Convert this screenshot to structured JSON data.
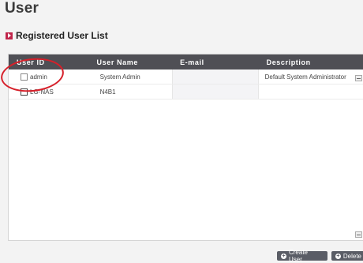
{
  "page": {
    "title": "User"
  },
  "section": {
    "title": "Registered User List"
  },
  "table": {
    "columns": [
      "User ID",
      "User Name",
      "E-mail",
      "Description"
    ],
    "rows": [
      {
        "user_id": "admin",
        "user_name": "System Admin",
        "email": "",
        "description": "Default System Administrator"
      },
      {
        "user_id": "LG-NAS",
        "user_name": "N4B1",
        "email": "",
        "description": ""
      }
    ]
  },
  "buttons": {
    "create_user": "Create User",
    "delete": "Delete"
  },
  "colors": {
    "header_bg": "#4f4f55",
    "accent": "#c0244a",
    "annotation": "#d6202a"
  }
}
